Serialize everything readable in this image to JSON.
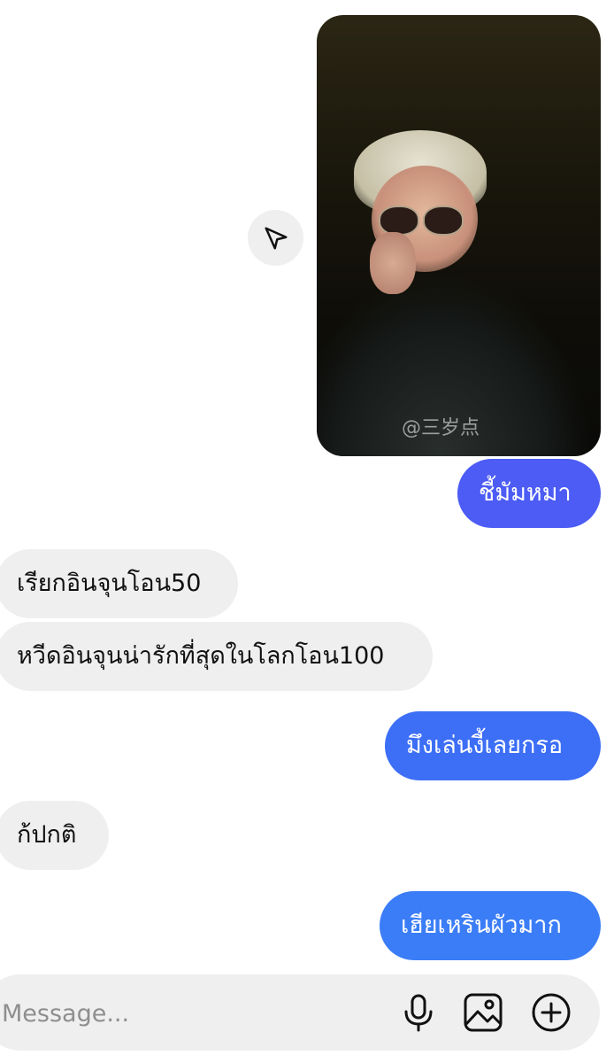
{
  "chat": {
    "photo": {
      "watermark": "@三岁点"
    },
    "messages": [
      {
        "direction": "outgoing",
        "text": "ชี้มัมหมา",
        "color": "#4c5cf4"
      },
      {
        "direction": "incoming",
        "text": "เรียกอินจุนโอน50"
      },
      {
        "direction": "incoming",
        "text": "หวีดอินจุนน่ารักที่สุดในโลกโอน100"
      },
      {
        "direction": "outgoing",
        "text": "มึงเล่นงี้เลยกรอ",
        "color": "#3c6ef6"
      },
      {
        "direction": "incoming",
        "text": "ก้ปกติ"
      },
      {
        "direction": "outgoing",
        "text": "เฮียเหรินผัวมาก",
        "color": "#3b7df7"
      }
    ]
  },
  "composer": {
    "placeholder": "Message...",
    "icons": [
      "microphone-icon",
      "gallery-icon",
      "plus-circle-icon"
    ]
  }
}
